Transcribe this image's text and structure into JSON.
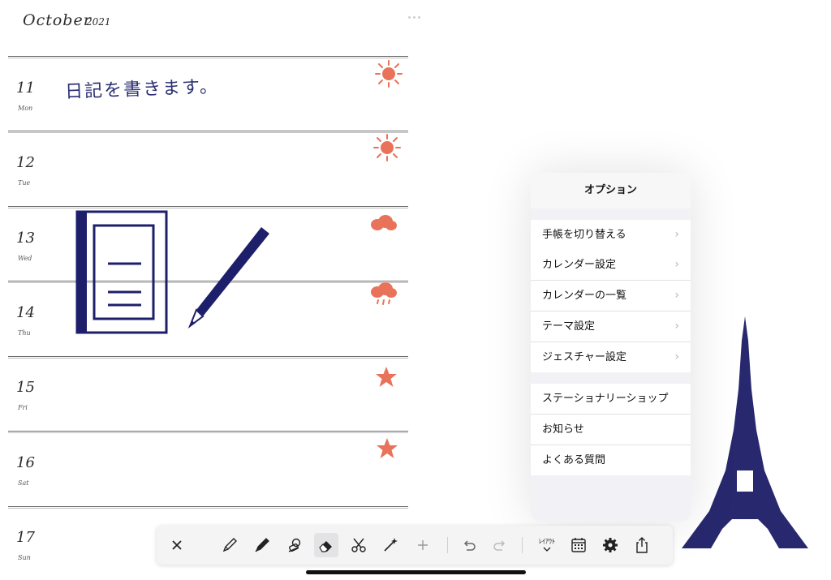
{
  "diary": {
    "month": "October",
    "year": "2021",
    "note": "日記を書きます。",
    "days": [
      {
        "num": "11",
        "wk": "Mon",
        "weather": "sun"
      },
      {
        "num": "12",
        "wk": "Tue",
        "weather": "sun"
      },
      {
        "num": "13",
        "wk": "Wed",
        "weather": "cloud"
      },
      {
        "num": "14",
        "wk": "Thu",
        "weather": "rain"
      },
      {
        "num": "15",
        "wk": "Fri",
        "weather": "star"
      },
      {
        "num": "16",
        "wk": "Sat",
        "weather": "star"
      },
      {
        "num": "17",
        "wk": "Sun",
        "weather": "none"
      }
    ]
  },
  "popover": {
    "title": "オプション",
    "group1": [
      "手帳を切り替える"
    ],
    "group2": [
      "カレンダー設定",
      "カレンダーの一覧",
      "テーマ設定",
      "ジェスチャー設定"
    ],
    "group3": [
      "ステーショナリーショップ",
      "お知らせ",
      "よくある質問"
    ]
  },
  "toolbar": {
    "layout_label": "ﾚｲｱｳﾄ",
    "tools": [
      "close-icon",
      "pencil-icon",
      "pen-icon",
      "stamp-icon",
      "eraser-icon",
      "scissors-icon",
      "magic-wand-icon",
      "plus-icon",
      "undo-icon",
      "redo-icon",
      "layout-icon",
      "calendar-icon",
      "gear-icon",
      "share-icon"
    ]
  },
  "colors": {
    "ink": "#2c2f72",
    "stamp": "#e8735a",
    "accent": "#1e1f6b"
  }
}
